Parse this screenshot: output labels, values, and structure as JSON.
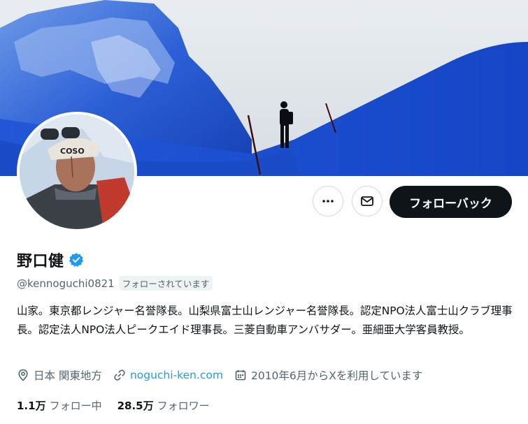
{
  "colors": {
    "accent": "#1d9bf0",
    "text_primary": "#0f1419",
    "text_secondary": "#536471",
    "follow_button_bg": "#0f1419",
    "sky_blue": "#1a4fc9"
  },
  "banner": {
    "image": "mountaineer-on-snow-ridge"
  },
  "avatar": {
    "image": "profile-photo-climber-with-goggles",
    "cap_text": "COSO"
  },
  "actions": {
    "more_icon": "ellipsis-icon",
    "message_icon": "envelope-icon",
    "follow_back_label": "フォローバック"
  },
  "profile": {
    "name": "野口健",
    "verified_icon": "verified-badge-icon",
    "handle": "@kennoguchi0821",
    "follows_you": "フォローされています",
    "bio": "山家。東京都レンジャー名誉隊長。山梨県富士山レンジャー名誉隊長。認定NPO法人富士山クラブ理事長。認定法人NPO法人ピークエイド理事長。三菱自動車アンバサダー。亜細亜大学客員教授。"
  },
  "meta": {
    "location_icon": "location-pin-icon",
    "location": "日本 関東地方",
    "link_icon": "link-icon",
    "website": "noguchi-ken.com",
    "calendar_icon": "calendar-icon",
    "joined": "2010年6月からXを利用しています"
  },
  "stats": {
    "following_count": "1.1万",
    "following_label": "フォロー中",
    "followers_count": "28.5万",
    "followers_label": "フォロワー"
  }
}
